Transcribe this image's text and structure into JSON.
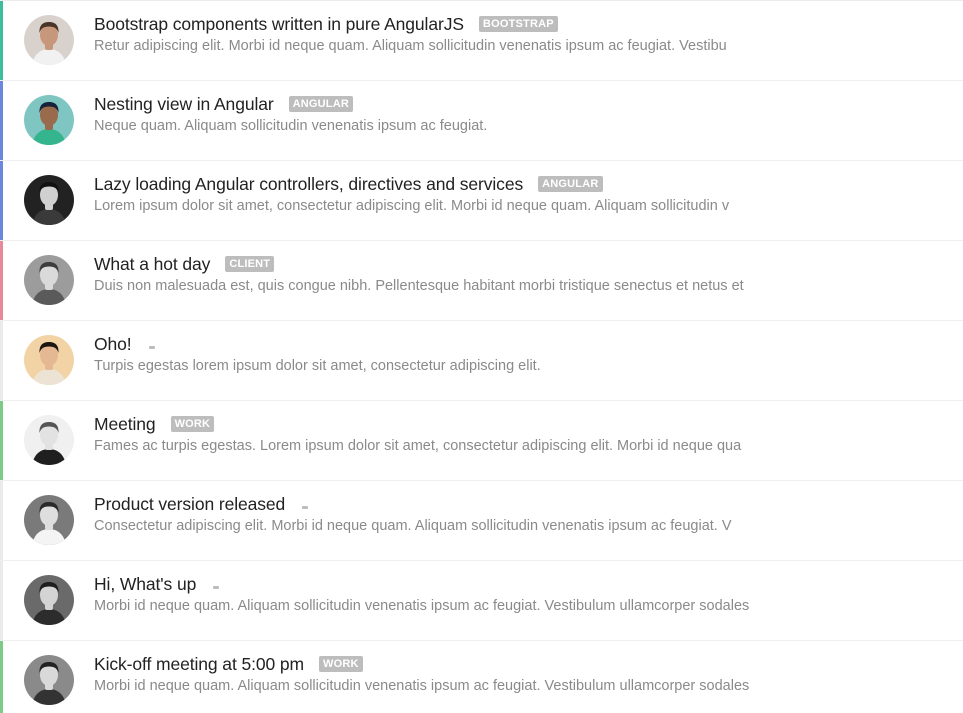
{
  "items": [
    {
      "title": "Bootstrap components written in pure AngularJS",
      "badge": "BOOTSTRAP",
      "desc": "Retur adipiscing elit. Morbi id neque quam. Aliquam sollicitudin venenatis ipsum ac feugiat. Vestibu",
      "accent": "#3dbd9b",
      "avatar": {
        "bg": "#d9d2cc",
        "skin": "#c7977c",
        "hair": "#4a3327",
        "shirt": "#f1f1f1"
      }
    },
    {
      "title": "Nesting view in Angular",
      "badge": "ANGULAR",
      "desc": "Neque quam. Aliquam sollicitudin venenatis ipsum ac feugiat.",
      "accent": "#6a86dd",
      "avatar": {
        "bg": "#7fc6c2",
        "skin": "#9a6a4d",
        "hair": "#16233a",
        "shirt": "#35b58e"
      }
    },
    {
      "title": "Lazy loading Angular controllers, directives and services",
      "badge": "ANGULAR",
      "desc": "Lorem ipsum dolor sit amet, consectetur adipiscing elit. Morbi id neque quam. Aliquam sollicitudin v",
      "accent": "#6a86dd",
      "avatar": {
        "bg": "#222222",
        "skin": "#d0d0d0",
        "hair": "#111111",
        "shirt": "#3a3a3a"
      }
    },
    {
      "title": "What a hot day",
      "badge": "CLIENT",
      "desc": "Duis non malesuada est, quis congue nibh. Pellentesque habitant morbi tristique senectus et netus et",
      "accent": "#e8899a",
      "avatar": {
        "bg": "#9c9c9c",
        "skin": "#dadada",
        "hair": "#3d3d3d",
        "shirt": "#5a5a5a"
      }
    },
    {
      "title": "Oho!",
      "badge": "",
      "desc": "Turpis egestas lorem ipsum dolor sit amet, consectetur adipiscing elit.",
      "accent": "#ebebeb",
      "avatar": {
        "bg": "#f2d3a6",
        "skin": "#e4b892",
        "hair": "#1d1510",
        "shirt": "#ede3d4"
      }
    },
    {
      "title": "Meeting",
      "badge": "WORK",
      "desc": "Fames ac turpis egestas. Lorem ipsum dolor sit amet, consectetur adipiscing elit. Morbi id neque qua",
      "accent": "#7ccb87",
      "avatar": {
        "bg": "#f0f0f0",
        "skin": "#e2e2e2",
        "hair": "#555555",
        "shirt": "#1f1f1f"
      }
    },
    {
      "title": "Product version released",
      "badge": "",
      "desc": "Consectetur adipiscing elit. Morbi id neque quam. Aliquam sollicitudin venenatis ipsum ac feugiat. V",
      "accent": "#ebebeb",
      "avatar": {
        "bg": "#7a7a7a",
        "skin": "#dedede",
        "hair": "#2a2a2a",
        "shirt": "#f4f4f4"
      }
    },
    {
      "title": "Hi, What's up",
      "badge": "",
      "desc": "Morbi id neque quam. Aliquam sollicitudin venenatis ipsum ac feugiat. Vestibulum ullamcorper sodales",
      "accent": "#ebebeb",
      "avatar": {
        "bg": "#6a6a6a",
        "skin": "#d4d4d4",
        "hair": "#1e1e1e",
        "shirt": "#2c2c2c"
      }
    },
    {
      "title": "Kick-off meeting at 5:00 pm",
      "badge": "WORK",
      "desc": "Morbi id neque quam. Aliquam sollicitudin venenatis ipsum ac feugiat. Vestibulum ullamcorper sodales",
      "accent": "#7ccb87",
      "avatar": {
        "bg": "#8a8a8a",
        "skin": "#d9d9d9",
        "hair": "#222222",
        "shirt": "#333333"
      }
    }
  ]
}
